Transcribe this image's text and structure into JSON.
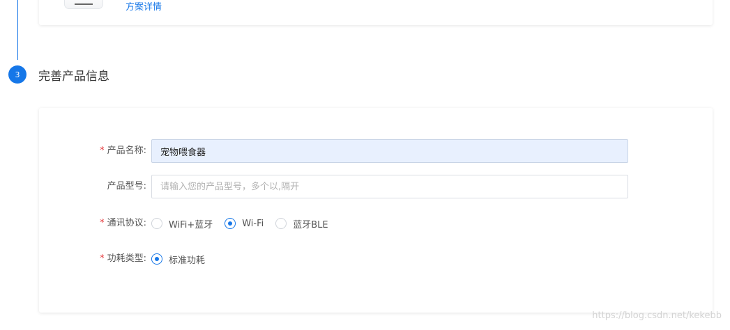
{
  "colors": {
    "accent": "#1677e8",
    "required": "#e4393c",
    "filled_bg": "#e8f0fe"
  },
  "top_card": {
    "device_icon": "device-thumbnail-icon",
    "details_link": "方案详情"
  },
  "step": {
    "number": "3",
    "title": "完善产品信息"
  },
  "form": {
    "product_name": {
      "required_mark": "*",
      "label": "产品名称:",
      "value": "宠物喂食器"
    },
    "product_model": {
      "label": "产品型号:",
      "value": "",
      "placeholder": "请输入您的产品型号，多个以,隔开"
    },
    "protocol": {
      "required_mark": "*",
      "label": "通讯协议:",
      "options": [
        {
          "label": "WiFi+蓝牙",
          "checked": false
        },
        {
          "label": "Wi-Fi",
          "checked": true
        },
        {
          "label": "蓝牙BLE",
          "checked": false
        }
      ]
    },
    "power": {
      "required_mark": "*",
      "label": "功耗类型:",
      "options": [
        {
          "label": "标准功耗",
          "checked": true
        }
      ]
    }
  },
  "watermark": "https://blog.csdn.net/kekebb"
}
